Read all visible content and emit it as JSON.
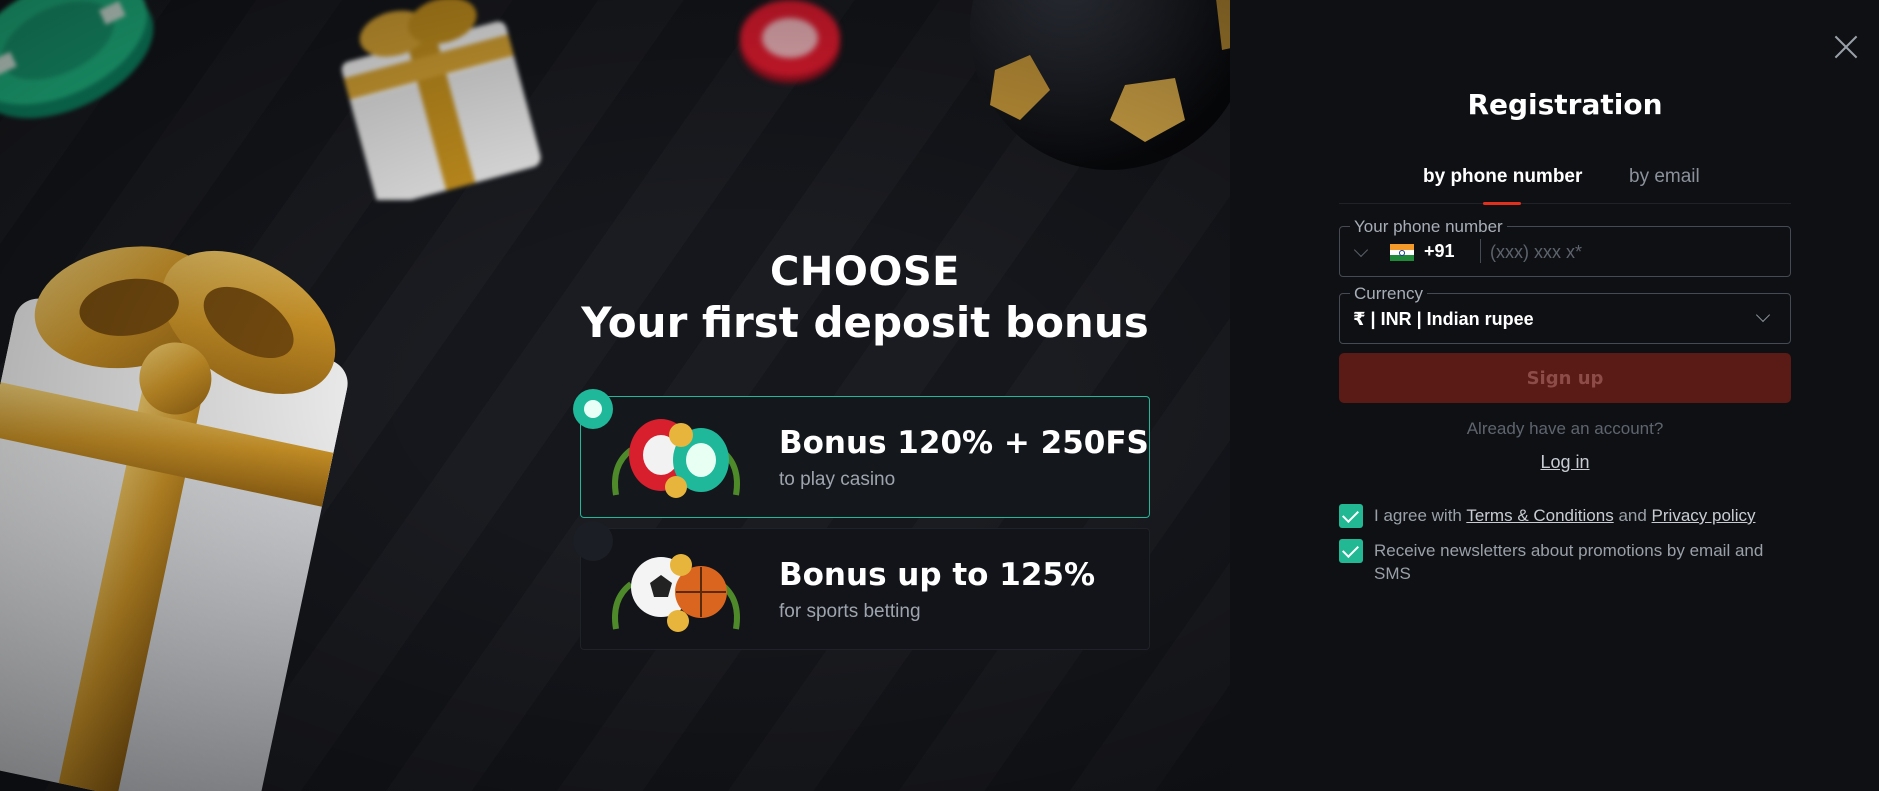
{
  "promo": {
    "headline_line1": "CHOOSE",
    "headline_line2": "Your first deposit bonus",
    "bonuses": [
      {
        "title": "Bonus 120% + 250FS",
        "subtitle": "to play casino",
        "selected": true,
        "art_icon": "casino-chips-icon"
      },
      {
        "title": "Bonus up to 125%",
        "subtitle": "for sports betting",
        "selected": false,
        "art_icon": "sports-balls-icon"
      }
    ],
    "accent_color": "#1fb89a"
  },
  "registration": {
    "title": "Registration",
    "tabs": [
      {
        "label": "by phone number",
        "active": true
      },
      {
        "label": "by email",
        "active": false
      }
    ],
    "phone": {
      "label": "Your phone number",
      "country_code": "+91",
      "flag": "india-flag-icon",
      "placeholder": "(xxx) xxx x*",
      "value": ""
    },
    "currency": {
      "label": "Currency",
      "value": "₹ | INR | Indian rupee"
    },
    "signup_label": "Sign up",
    "already_text": "Already have an account?",
    "login_label": "Log in",
    "agree": {
      "prefix": "I agree with",
      "terms_link": "Terms & Conditions",
      "conjunction": "and",
      "privacy_link": "Privacy policy",
      "checked": true
    },
    "newsletter": {
      "text": "Receive newsletters about promotions by email and SMS",
      "checked": true
    },
    "colors": {
      "signup_bg": "#5a1a16",
      "checkbox": "#22b893",
      "tab_underline": "#e2301f"
    }
  }
}
